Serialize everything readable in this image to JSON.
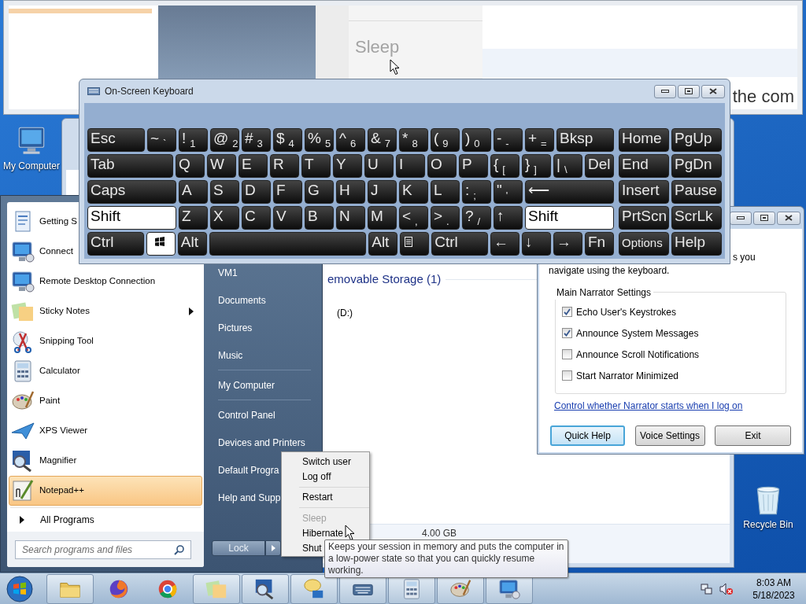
{
  "top_window": {
    "menu_item": "Sleep",
    "text": "the com"
  },
  "desktop_icons": [
    {
      "kind": "computer",
      "label": "My Computer"
    },
    {
      "kind": "bin",
      "label": "Recycle Bin"
    }
  ],
  "explorer": {
    "heading": "emovable Storage (1)",
    "drive": "(D:)",
    "details": "4.00 GB"
  },
  "narrator": {
    "intro_end": "s you",
    "intro": "navigate using the keyboard.",
    "group_title": "Main Narrator Settings",
    "options": [
      {
        "label": "Echo User's Keystrokes",
        "checked": true
      },
      {
        "label": "Announce System Messages",
        "checked": true
      },
      {
        "label": "Announce Scroll Notifications",
        "checked": false
      },
      {
        "label": "Start Narrator Minimized",
        "checked": false
      }
    ],
    "link": "Control whether Narrator starts when I log on",
    "buttons": [
      {
        "label": "Quick Help",
        "focused": true
      },
      {
        "label": "Voice Settings",
        "focused": false
      },
      {
        "label": "Exit",
        "focused": false
      }
    ]
  },
  "start_menu": {
    "programs": [
      {
        "kind": "document",
        "label": "Getting S",
        "has_submenu": false,
        "selected": false
      },
      {
        "kind": "monitor",
        "label": "Connect",
        "has_submenu": false,
        "selected": false
      },
      {
        "kind": "monitor",
        "label": "Remote Desktop Connection",
        "has_submenu": false,
        "selected": false
      },
      {
        "kind": "sticky",
        "label": "Sticky Notes",
        "has_submenu": true,
        "selected": false
      },
      {
        "kind": "scissors",
        "label": "Snipping Tool",
        "has_submenu": false,
        "selected": false
      },
      {
        "kind": "calculator",
        "label": "Calculator",
        "has_submenu": false,
        "selected": false
      },
      {
        "kind": "palette",
        "label": "Paint",
        "has_submenu": false,
        "selected": false
      },
      {
        "kind": "plane",
        "label": "XPS Viewer",
        "has_submenu": false,
        "selected": false
      },
      {
        "kind": "magnifier",
        "label": "Magnifier",
        "has_submenu": false,
        "selected": false
      },
      {
        "kind": "notepad",
        "label": "Notepad++",
        "has_submenu": false,
        "selected": true
      }
    ],
    "all_programs": "All Programs",
    "search": {
      "placeholder": "Search programs and files"
    },
    "places": [
      {
        "kind": "link",
        "label": "VM1"
      },
      {
        "kind": "link",
        "label": "Documents"
      },
      {
        "kind": "link",
        "label": "Pictures"
      },
      {
        "kind": "link",
        "label": "Music"
      },
      {
        "kind": "separator"
      },
      {
        "kind": "link",
        "label": "My Computer"
      },
      {
        "kind": "separator"
      },
      {
        "kind": "link",
        "label": "Control Panel"
      },
      {
        "kind": "link",
        "label": "Devices and Printers"
      },
      {
        "kind": "link",
        "label": "Default Progra"
      },
      {
        "kind": "link",
        "label": "Help and Supp"
      }
    ],
    "lock_button": "Lock"
  },
  "shutdown_menu": [
    {
      "kind": "item",
      "label": "Switch user",
      "disabled": false
    },
    {
      "kind": "item",
      "label": "Log off",
      "disabled": false
    },
    {
      "kind": "separator"
    },
    {
      "kind": "item",
      "label": "Restart",
      "disabled": false
    },
    {
      "kind": "separator"
    },
    {
      "kind": "item",
      "label": "Sleep",
      "disabled": true
    },
    {
      "kind": "item",
      "label": "Hibernate",
      "disabled": false
    },
    {
      "kind": "item",
      "label": "Shut",
      "disabled": false
    }
  ],
  "tooltip": "Keeps your session in memory and puts the computer in a low-power state so that you can quickly resume working.",
  "keyboard": {
    "title": "On-Screen Keyboard",
    "rows": [
      {
        "keys": [
          {
            "kind": "wide",
            "label": "Esc",
            "pressed": false
          },
          {
            "kind": "key",
            "label": "~",
            "sub": "`",
            "pressed": false
          },
          {
            "kind": "key",
            "label": "!",
            "sub": "1",
            "pressed": false
          },
          {
            "kind": "key",
            "label": "@",
            "sub": "2",
            "pressed": false
          },
          {
            "kind": "key",
            "label": "#",
            "sub": "3",
            "pressed": false
          },
          {
            "kind": "key",
            "label": "$",
            "sub": "4",
            "pressed": false
          },
          {
            "kind": "key",
            "label": "%",
            "sub": "5",
            "pressed": false
          },
          {
            "kind": "key",
            "label": "^",
            "sub": "6",
            "pressed": false
          },
          {
            "kind": "key",
            "label": "&",
            "sub": "7",
            "pressed": false
          },
          {
            "kind": "key",
            "label": "*",
            "sub": "8",
            "pressed": false
          },
          {
            "kind": "key",
            "label": "(",
            "sub": "9",
            "pressed": false
          },
          {
            "kind": "key",
            "label": ")",
            "sub": "0",
            "pressed": false
          },
          {
            "kind": "key",
            "label": "-",
            "sub": "-",
            "pressed": false
          },
          {
            "kind": "key",
            "label": "+",
            "sub": "=",
            "pressed": false
          },
          {
            "kind": "wide",
            "label": "Bksp",
            "pressed": false
          }
        ]
      },
      {
        "keys": [
          {
            "kind": "wide",
            "label": "Tab",
            "pressed": false
          },
          {
            "kind": "key",
            "label": "Q",
            "pressed": false
          },
          {
            "kind": "key",
            "label": "W",
            "pressed": false
          },
          {
            "kind": "key",
            "label": "E",
            "pressed": false
          },
          {
            "kind": "key",
            "label": "R",
            "pressed": false
          },
          {
            "kind": "key",
            "label": "T",
            "pressed": false
          },
          {
            "kind": "key",
            "label": "Y",
            "pressed": false
          },
          {
            "kind": "key",
            "label": "U",
            "pressed": false
          },
          {
            "kind": "key",
            "label": "I",
            "pressed": false
          },
          {
            "kind": "key",
            "label": "O",
            "pressed": false
          },
          {
            "kind": "key",
            "label": "P",
            "pressed": false
          },
          {
            "kind": "key",
            "label": "{",
            "sub": "[",
            "pressed": false
          },
          {
            "kind": "key",
            "label": "}",
            "sub": "]",
            "pressed": false
          },
          {
            "kind": "key",
            "label": "|",
            "sub": "\\",
            "pressed": false
          },
          {
            "kind": "key",
            "label": "Del",
            "pressed": false
          }
        ]
      },
      {
        "keys": [
          {
            "kind": "wide",
            "label": "Caps",
            "pressed": false
          },
          {
            "kind": "key",
            "label": "A",
            "pressed": false
          },
          {
            "kind": "key",
            "label": "S",
            "pressed": false
          },
          {
            "kind": "key",
            "label": "D",
            "pressed": false
          },
          {
            "kind": "key",
            "label": "F",
            "pressed": false
          },
          {
            "kind": "key",
            "label": "G",
            "pressed": false
          },
          {
            "kind": "key",
            "label": "H",
            "pressed": false
          },
          {
            "kind": "key",
            "label": "J",
            "pressed": false
          },
          {
            "kind": "key",
            "label": "K",
            "pressed": false
          },
          {
            "kind": "key",
            "label": "L",
            "pressed": false
          },
          {
            "kind": "key",
            "label": ":",
            "sub": ";",
            "pressed": false
          },
          {
            "kind": "key",
            "label": "\"",
            "sub": "'",
            "pressed": false
          },
          {
            "kind": "wide",
            "label": "⟵",
            "pressed": false
          }
        ]
      },
      {
        "keys": [
          {
            "kind": "wide",
            "label": "Shift",
            "pressed": true
          },
          {
            "kind": "key",
            "label": "Z",
            "pressed": false
          },
          {
            "kind": "key",
            "label": "X",
            "pressed": false
          },
          {
            "kind": "key",
            "label": "C",
            "pressed": false
          },
          {
            "kind": "key",
            "label": "V",
            "pressed": false
          },
          {
            "kind": "key",
            "label": "B",
            "pressed": false
          },
          {
            "kind": "key",
            "label": "N",
            "pressed": false
          },
          {
            "kind": "key",
            "label": "M",
            "pressed": false
          },
          {
            "kind": "key",
            "label": "<",
            "sub": ",",
            "pressed": false
          },
          {
            "kind": "key",
            "label": ">",
            "sub": ".",
            "pressed": false
          },
          {
            "kind": "key",
            "label": "?",
            "sub": "/",
            "pressed": false
          },
          {
            "kind": "key",
            "label": "↑",
            "pressed": false
          },
          {
            "kind": "wide",
            "label": "Shift",
            "pressed": true
          }
        ]
      },
      {
        "keys": [
          {
            "kind": "wide",
            "label": "Ctrl",
            "pressed": false
          },
          {
            "kind": "win",
            "pressed": true
          },
          {
            "kind": "key",
            "label": "Alt",
            "pressed": false
          },
          {
            "kind": "space",
            "pressed": false
          },
          {
            "kind": "key",
            "label": "Alt",
            "pressed": false
          },
          {
            "kind": "menu",
            "pressed": false
          },
          {
            "kind": "wide",
            "label": "Ctrl",
            "pressed": false
          },
          {
            "kind": "key",
            "label": "←",
            "pressed": false
          },
          {
            "kind": "key",
            "label": "↓",
            "pressed": false
          },
          {
            "kind": "key",
            "label": "→",
            "pressed": false
          },
          {
            "kind": "key",
            "label": "Fn",
            "pressed": false
          }
        ]
      }
    ],
    "nav_rows": [
      {
        "keys": [
          {
            "kind": "nav",
            "label": "Home",
            "pressed": false
          },
          {
            "kind": "nav",
            "label": "PgUp",
            "pressed": false
          }
        ]
      },
      {
        "keys": [
          {
            "kind": "nav",
            "label": "End",
            "pressed": false
          },
          {
            "kind": "nav",
            "label": "PgDn",
            "pressed": false
          }
        ]
      },
      {
        "keys": [
          {
            "kind": "nav",
            "label": "Insert",
            "pressed": false
          },
          {
            "kind": "nav",
            "label": "Pause",
            "pressed": false
          }
        ]
      },
      {
        "keys": [
          {
            "kind": "nav",
            "label": "PrtScn",
            "pressed": false
          },
          {
            "kind": "nav",
            "label": "ScrLk",
            "pressed": false
          }
        ]
      },
      {
        "keys": [
          {
            "kind": "nav",
            "label": "Options",
            "pressed": false
          },
          {
            "kind": "nav",
            "label": "Help",
            "pressed": false
          }
        ]
      }
    ]
  },
  "taskbar": {
    "items": [
      {
        "kind": "folder",
        "running": true
      },
      {
        "kind": "browser_orange",
        "running": false
      },
      {
        "kind": "browser_round",
        "running": false
      },
      {
        "kind": "sticky",
        "running": true
      },
      {
        "kind": "magnifier",
        "running": true
      },
      {
        "kind": "speech",
        "running": true
      },
      {
        "kind": "keyboard",
        "running": true
      },
      {
        "kind": "calculator",
        "running": true
      },
      {
        "kind": "palette",
        "running": true
      },
      {
        "kind": "monitor",
        "running": true
      }
    ],
    "clock": {
      "time": "8:03 AM",
      "date": "5/18/2023"
    }
  }
}
